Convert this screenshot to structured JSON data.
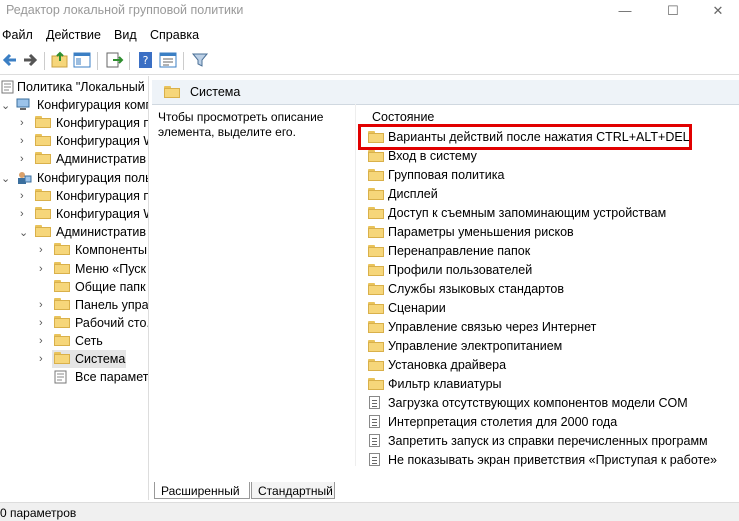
{
  "window": {
    "title": "Редактор локальной групповой политики",
    "controls": [
      "—",
      "☐",
      "✕"
    ]
  },
  "menu": [
    "Файл",
    "Действие",
    "Вид",
    "Справка"
  ],
  "tree": {
    "items": [
      {
        "label": "Политика \"Локальный",
        "indent": 0
      },
      {
        "label": "Конфигурация комп",
        "indent": 1
      },
      {
        "label": "Конфигурация п",
        "indent": 2
      },
      {
        "label": "Конфигурация W",
        "indent": 2
      },
      {
        "label": "Административ",
        "indent": 2
      },
      {
        "label": "Конфигурация поль",
        "indent": 1
      },
      {
        "label": "Конфигурация п",
        "indent": 2
      },
      {
        "label": "Конфигурация W",
        "indent": 2
      },
      {
        "label": "Административ",
        "indent": 2
      },
      {
        "label": "Компоненты",
        "indent": 3
      },
      {
        "label": "Меню «Пуск",
        "indent": 3
      },
      {
        "label": "Общие папк",
        "indent": 3
      },
      {
        "label": "Панель упра",
        "indent": 3
      },
      {
        "label": "Рабочий сто.",
        "indent": 3
      },
      {
        "label": "Сеть",
        "indent": 3
      },
      {
        "label": "Система",
        "indent": 3
      },
      {
        "label": "Все параметр",
        "indent": 3
      }
    ]
  },
  "header": {
    "title": "Система"
  },
  "description": "Чтобы просмотреть описание элемента, выделите его.",
  "list": {
    "column": "Состояние",
    "items": [
      {
        "label": "Варианты действий после нажатия CTRL+ALT+DEL",
        "type": "folder"
      },
      {
        "label": "Вход в систему",
        "type": "folder"
      },
      {
        "label": "Групповая политика",
        "type": "folder"
      },
      {
        "label": "Дисплей",
        "type": "folder"
      },
      {
        "label": "Доступ к съемным запоминающим устройствам",
        "type": "folder"
      },
      {
        "label": "Параметры уменьшения рисков",
        "type": "folder"
      },
      {
        "label": "Перенаправление папок",
        "type": "folder"
      },
      {
        "label": "Профили пользователей",
        "type": "folder"
      },
      {
        "label": "Службы языковых стандартов",
        "type": "folder"
      },
      {
        "label": "Сценарии",
        "type": "folder"
      },
      {
        "label": "Управление связью через Интернет",
        "type": "folder"
      },
      {
        "label": "Управление электропитанием",
        "type": "folder"
      },
      {
        "label": "Установка драйвера",
        "type": "folder"
      },
      {
        "label": "Фильтр клавиатуры",
        "type": "folder"
      },
      {
        "label": "Загрузка отсутствующих компонентов модели COM",
        "type": "policy"
      },
      {
        "label": "Интерпретация столетия для 2000 года",
        "type": "policy"
      },
      {
        "label": "Запретить запуск из справки перечисленных программ",
        "type": "policy"
      },
      {
        "label": "Не показывать экран приветствия «Приступая к работе»",
        "type": "policy"
      }
    ]
  },
  "tabs": [
    "Расширенный",
    "Стандартный"
  ],
  "status": "0 параметров"
}
